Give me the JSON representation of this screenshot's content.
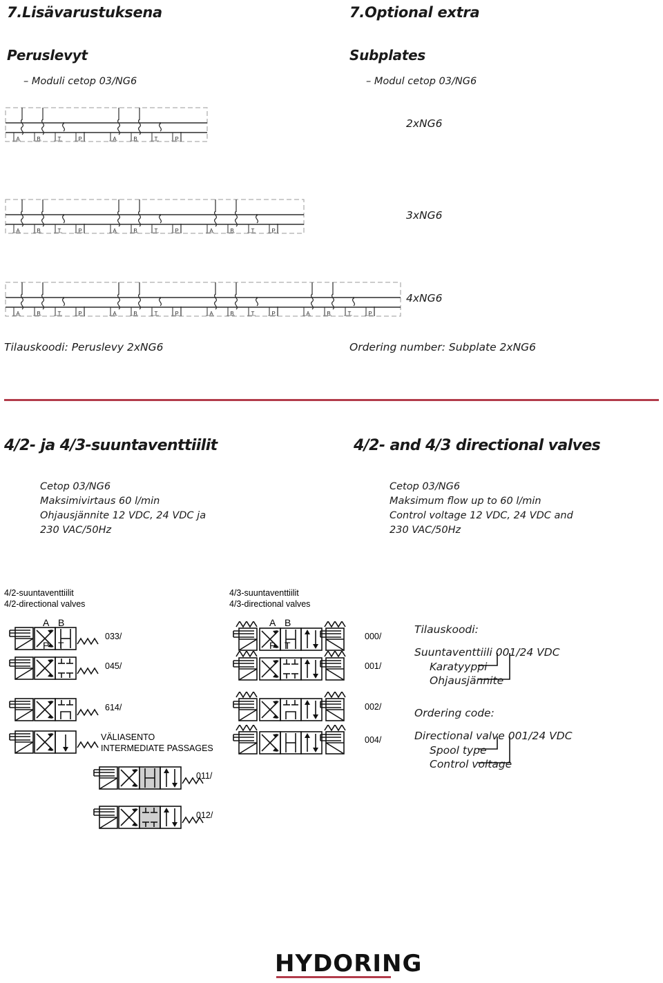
{
  "header": {
    "section_number_fi": "7.Lisävarustuksena",
    "section_number_en": "7.Optional extra",
    "group_fi": "Peruslevyt",
    "group_en": "Subplates",
    "sub_fi": "– Moduli cetop 03/NG6",
    "sub_en": "– Modul cetop 03/NG6"
  },
  "subplates": [
    {
      "label": "2xNG6",
      "modules": 2
    },
    {
      "label": "3xNG6",
      "modules": 3
    },
    {
      "label": "4xNG6",
      "modules": 4
    }
  ],
  "port_labels": [
    "A",
    "B",
    "T",
    "P"
  ],
  "ordering_plate": {
    "fi": "Tilauskoodi: Peruslevy 2xNG6",
    "en": "Ordering number: Subplate 2xNG6"
  },
  "valves_section": {
    "title_fi": "4/2- ja 4/3-suuntaventtiilit",
    "title_en": "4/2- and 4/3 directional valves",
    "specs_fi": [
      "Cetop 03/NG6",
      "Maksimivirtaus 60 l/min",
      "Ohjausjännite 12 VDC, 24 VDC ja",
      "230 VAC/50Hz"
    ],
    "specs_en": [
      "Cetop 03/NG6",
      "Maksimum flow up to 60 l/min",
      "Control voltage 12 VDC, 24 VDC and",
      "230 VAC/50Hz"
    ]
  },
  "col_42": {
    "heading_fi": "4/2-suuntaventtiilit",
    "heading_en": "4/2-directional valves",
    "port_top": [
      "A",
      "B"
    ],
    "port_bottom": [
      "P",
      "T"
    ],
    "codes": [
      "033/",
      "045/",
      "614/"
    ],
    "intermediate_fi": "VÄLIASENTO",
    "intermediate_en": "INTERMEDIATE PASSAGES",
    "intermediate_codes": [
      "011/",
      "012/"
    ]
  },
  "col_43": {
    "heading_fi": "4/3-suuntaventtiilit",
    "heading_en": "4/3-directional valves",
    "port_top": [
      "A",
      "B"
    ],
    "port_bottom": [
      "P",
      "T"
    ],
    "codes": [
      "000/",
      "001/",
      "002/",
      "004/"
    ]
  },
  "ordering_code": {
    "fi_title": "Tilauskoodi:",
    "fi_line1": "Suuntaventtiili 001/24 VDC",
    "fi_line2": "Karatyyppi",
    "fi_line3": "Ohjausjännite",
    "en_title": "Ordering code:",
    "en_line1": "Directional valve 001/24 VDC",
    "en_line2": "Spool type",
    "en_line3": "Control voltage"
  },
  "footer": {
    "logo": "HYDORING"
  },
  "colors": {
    "accent_red": "#b23b4a",
    "ink": "#1a1a1a",
    "shade_gray": "#cfcfcf"
  }
}
